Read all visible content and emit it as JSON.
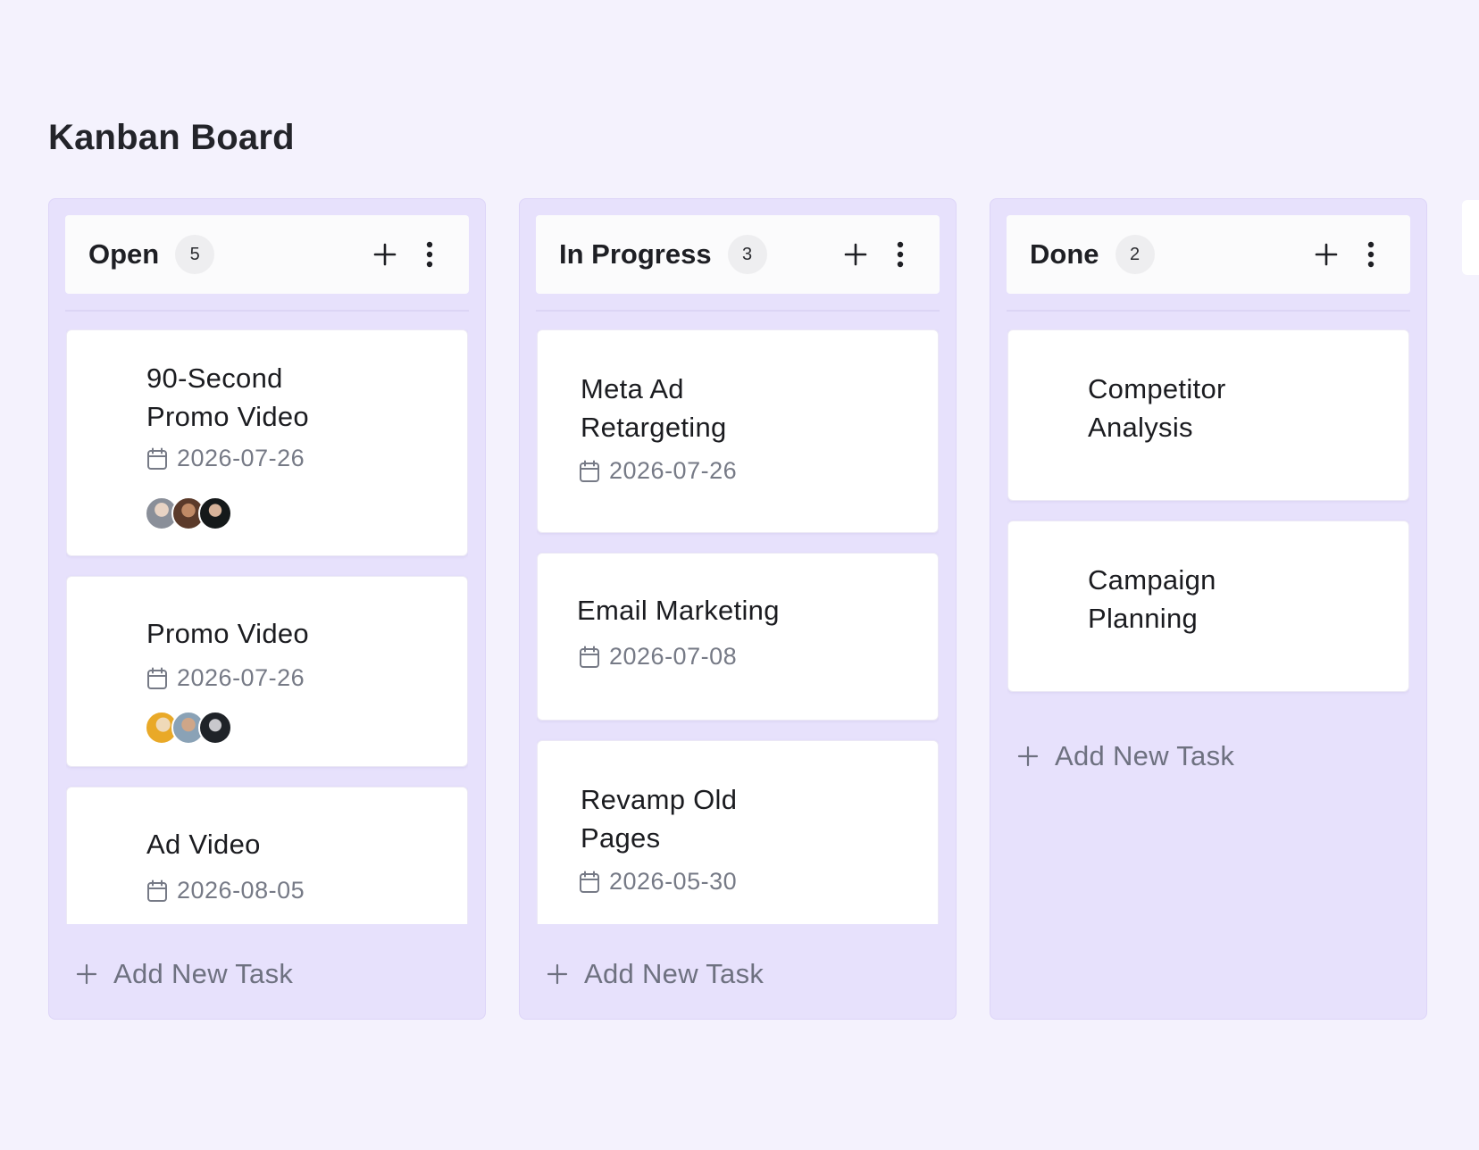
{
  "page": {
    "title": "Kanban Board"
  },
  "columns": [
    {
      "title": "Open",
      "count": "5",
      "add_task_label": "Add New Task",
      "cards": [
        {
          "title": "90-Second\nPromo Video",
          "date": "2026-07-26",
          "avatars": [
            "avatar-1",
            "avatar-2",
            "avatar-3"
          ]
        },
        {
          "title": "Promo Video",
          "date": "2026-07-26",
          "avatars": [
            "avatar-4",
            "avatar-5",
            "avatar-6"
          ]
        },
        {
          "title": "Ad Video",
          "date": "2026-08-05"
        }
      ]
    },
    {
      "title": "In Progress",
      "count": "3",
      "add_task_label": "Add New Task",
      "cards": [
        {
          "title": "Meta Ad\nRetargeting",
          "date": "2026-07-26"
        },
        {
          "title": "Email Marketing",
          "date": "2026-07-08"
        },
        {
          "title": "Revamp Old\nPages",
          "date": "2026-05-30"
        }
      ]
    },
    {
      "title": "Done",
      "count": "2",
      "add_task_label": "Add New Task",
      "cards": [
        {
          "title": "Competitor\nAnalysis"
        },
        {
          "title": "Campaign\nPlanning"
        }
      ]
    }
  ],
  "icons": {
    "add": "plus-icon",
    "more": "more-vertical-icon",
    "date": "calendar-icon"
  },
  "colors": {
    "background": "#f4f2fd",
    "column": "#e7e1fc",
    "card": "#ffffff",
    "muted_text": "#767a86"
  }
}
